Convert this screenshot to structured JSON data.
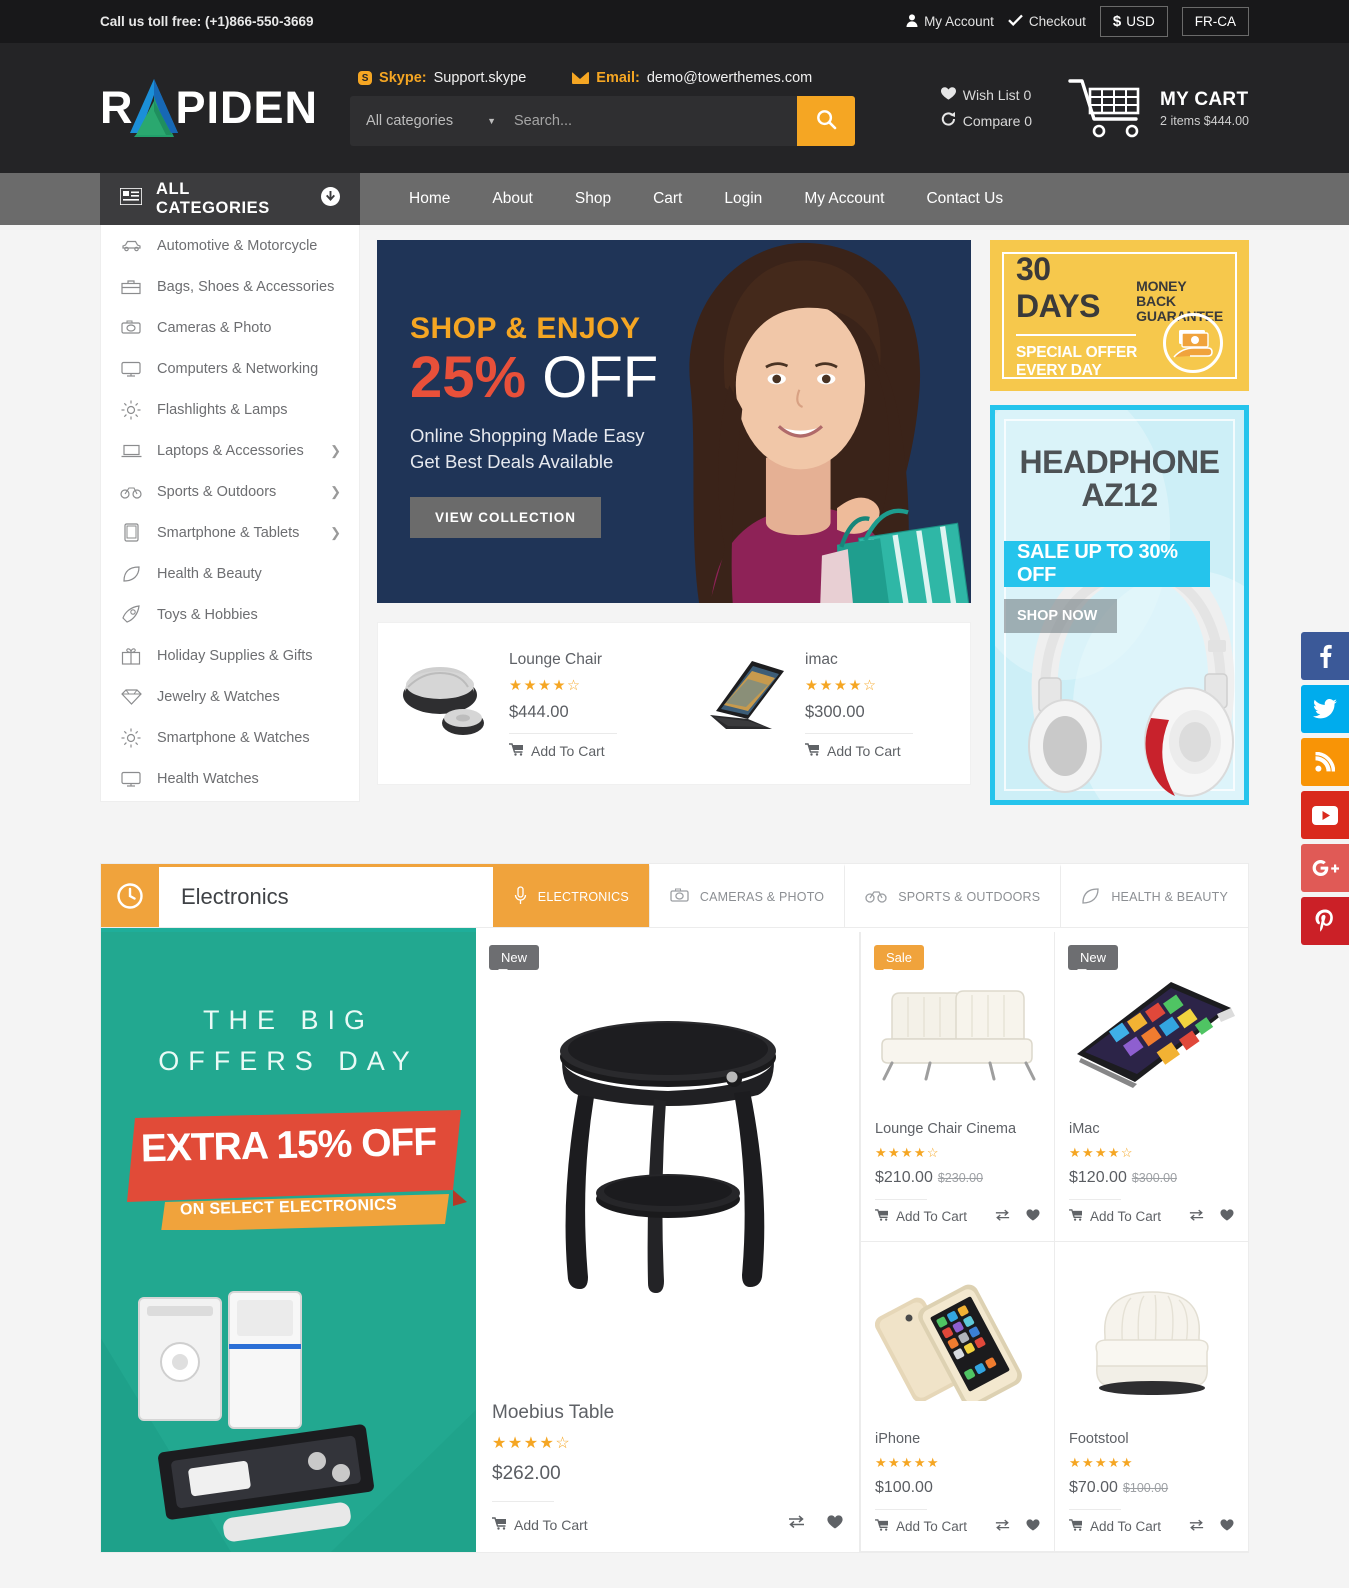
{
  "topbar": {
    "phone_label": "Call us toll free:",
    "phone_number": "(+1)866-550-3669",
    "my_account": "My Account",
    "checkout": "Checkout",
    "currency": "USD",
    "currency_symbol": "$",
    "language": "FR-CA"
  },
  "header": {
    "logo_left": "R",
    "logo_right": "PIDEN",
    "skype_label": "Skype:",
    "skype_value": "Support.skype",
    "email_label": "Email:",
    "email_value": "demo@towerthemes.com",
    "search_category": "All categories",
    "search_placeholder": "Search...",
    "search_value": "",
    "wishlist": "Wish List 0",
    "compare": "Compare 0",
    "cart_title": "MY CART",
    "cart_sub": "2 items $444.00"
  },
  "nav": {
    "all_categories": "ALL CATEGORIES",
    "links": [
      "Home",
      "About",
      "Shop",
      "Cart",
      "Login",
      "My Account",
      "Contact Us"
    ]
  },
  "sidebar": {
    "items": [
      {
        "label": "Automotive & Motorcycle",
        "icon": "car-icon",
        "has_children": false
      },
      {
        "label": "Bags, Shoes & Accessories",
        "icon": "bag-icon",
        "has_children": false
      },
      {
        "label": "Cameras & Photo",
        "icon": "camera-icon",
        "has_children": false
      },
      {
        "label": "Computers & Networking",
        "icon": "monitor-icon",
        "has_children": false
      },
      {
        "label": "Flashlights & Lamps",
        "icon": "sun-icon",
        "has_children": false
      },
      {
        "label": "Laptops & Accessories",
        "icon": "laptop-icon",
        "has_children": true
      },
      {
        "label": "Sports & Outdoors",
        "icon": "bicycle-icon",
        "has_children": true
      },
      {
        "label": "Smartphone & Tablets",
        "icon": "tablet-icon",
        "has_children": true
      },
      {
        "label": "Health & Beauty",
        "icon": "leaf-icon",
        "has_children": false
      },
      {
        "label": "Toys & Hobbies",
        "icon": "rocket-icon",
        "has_children": false
      },
      {
        "label": "Holiday Supplies & Gifts",
        "icon": "gift-icon",
        "has_children": false
      },
      {
        "label": "Jewelry & Watches",
        "icon": "diamond-icon",
        "has_children": false
      },
      {
        "label": "Smartphone & Watches",
        "icon": "sun-icon",
        "has_children": false
      },
      {
        "label": "Health Watches",
        "icon": "monitor-icon",
        "has_children": false
      }
    ]
  },
  "hero": {
    "kicker": "SHOP & ENJOY",
    "percent": "25%",
    "off": "OFF",
    "sub_line1": "Online Shopping Made Easy",
    "sub_line2": "Get Best Deals Available",
    "button": "VIEW COLLECTION"
  },
  "mini_products": [
    {
      "name": "Lounge Chair",
      "rating": 4,
      "price": "$444.00",
      "add_to_cart": "Add To Cart"
    },
    {
      "name": "imac",
      "rating": 4,
      "price": "$300.00",
      "add_to_cart": "Add To Cart"
    }
  ],
  "banner_money": {
    "days": "30 DAYS",
    "guarantee_line1": "MONEY BACK",
    "guarantee_line2": "GUARANTEE",
    "offer_line1": "SPECIAL OFFER",
    "offer_line2": "EVERY DAY"
  },
  "banner_headphone": {
    "title_line1": "HEADPHONE",
    "title_line2": "AZ12",
    "sale": "SALE UP TO 30% OFF",
    "shop_now": "SHOP NOW"
  },
  "electronics": {
    "title": "Electronics",
    "tabs": [
      {
        "label": "ELECTRONICS",
        "icon": "microphone-icon",
        "active": true
      },
      {
        "label": "CAMERAS & PHOTO",
        "icon": "camera-icon",
        "active": false
      },
      {
        "label": "SPORTS & OUTDOORS",
        "icon": "bicycle-icon",
        "active": false
      },
      {
        "label": "HEALTH & BEAUTY",
        "icon": "leaf-icon",
        "active": false
      }
    ],
    "promo": {
      "line1": "THE BIG",
      "line2": "OFFERS DAY",
      "extra": "EXTRA 15% OFF",
      "select": "ON SELECT ELECTRONICS"
    },
    "featured": {
      "badge": "New",
      "name": "Moebius Table",
      "rating": 4,
      "price": "$262.00",
      "add_to_cart": "Add To Cart"
    },
    "grid": [
      {
        "badge": "Sale",
        "badge_type": "sale",
        "name": "Lounge Chair Cinema",
        "rating": 4,
        "price": "$210.00",
        "old_price": "$230.00",
        "add_to_cart": "Add To Cart",
        "image": "sofa-image"
      },
      {
        "badge": "New",
        "badge_type": "new",
        "name": "iMac",
        "rating": 4,
        "price": "$120.00",
        "old_price": "$300.00",
        "add_to_cart": "Add To Cart",
        "image": "tablet-image"
      },
      {
        "badge": "",
        "badge_type": "",
        "name": "iPhone",
        "rating": 5,
        "price": "$100.00",
        "old_price": "",
        "add_to_cart": "Add To Cart",
        "image": "iphone-image"
      },
      {
        "badge": "",
        "badge_type": "",
        "name": "Footstool",
        "rating": 5,
        "price": "$70.00",
        "old_price": "$100.00",
        "add_to_cart": "Add To Cart",
        "image": "armchair-image"
      }
    ]
  },
  "social": [
    {
      "name": "facebook",
      "glyph": "f",
      "color": "#3b5998"
    },
    {
      "name": "twitter",
      "glyph": "ᵗ",
      "color": "#00aced"
    },
    {
      "name": "rss",
      "glyph": "◠",
      "color": "#f89406"
    },
    {
      "name": "youtube",
      "glyph": "▶",
      "color": "#d9291c"
    },
    {
      "name": "google-plus",
      "glyph": "G+",
      "color": "#e05a56"
    },
    {
      "name": "pinterest",
      "glyph": "$",
      "color": "#cb2027"
    }
  ],
  "colors": {
    "accent": "#f5a623",
    "dark": "#242426",
    "nav": "#6b6b6b",
    "teal": "#22a890",
    "cyan": "#25c4ec"
  }
}
